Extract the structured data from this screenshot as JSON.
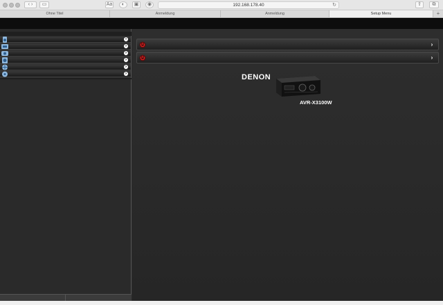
{
  "browser": {
    "url": "192.168.178.40",
    "tabs": [
      {
        "label": "Ohne Titel",
        "active": false
      },
      {
        "label": "Anmeldung",
        "active": false
      },
      {
        "label": "Anmeldung",
        "active": false
      },
      {
        "label": "Setup Menu",
        "active": true
      }
    ],
    "icons": [
      "back-icon",
      "forward-icon",
      "sidebar-icon",
      "reader-icon",
      "privacy-icon",
      "lock-icon",
      "ad-block-icon",
      "reload-icon",
      "share-icon",
      "tabs-icon",
      "new-tab-icon"
    ]
  },
  "sidebar": {
    "item_count": 7
  },
  "main": {
    "zones": [
      "zone-1",
      "zone-2"
    ],
    "brand": "DENON",
    "model": "AVR-X3100W",
    "colors": {
      "power": "#d41f1f",
      "background": "#2b2b2b"
    }
  }
}
